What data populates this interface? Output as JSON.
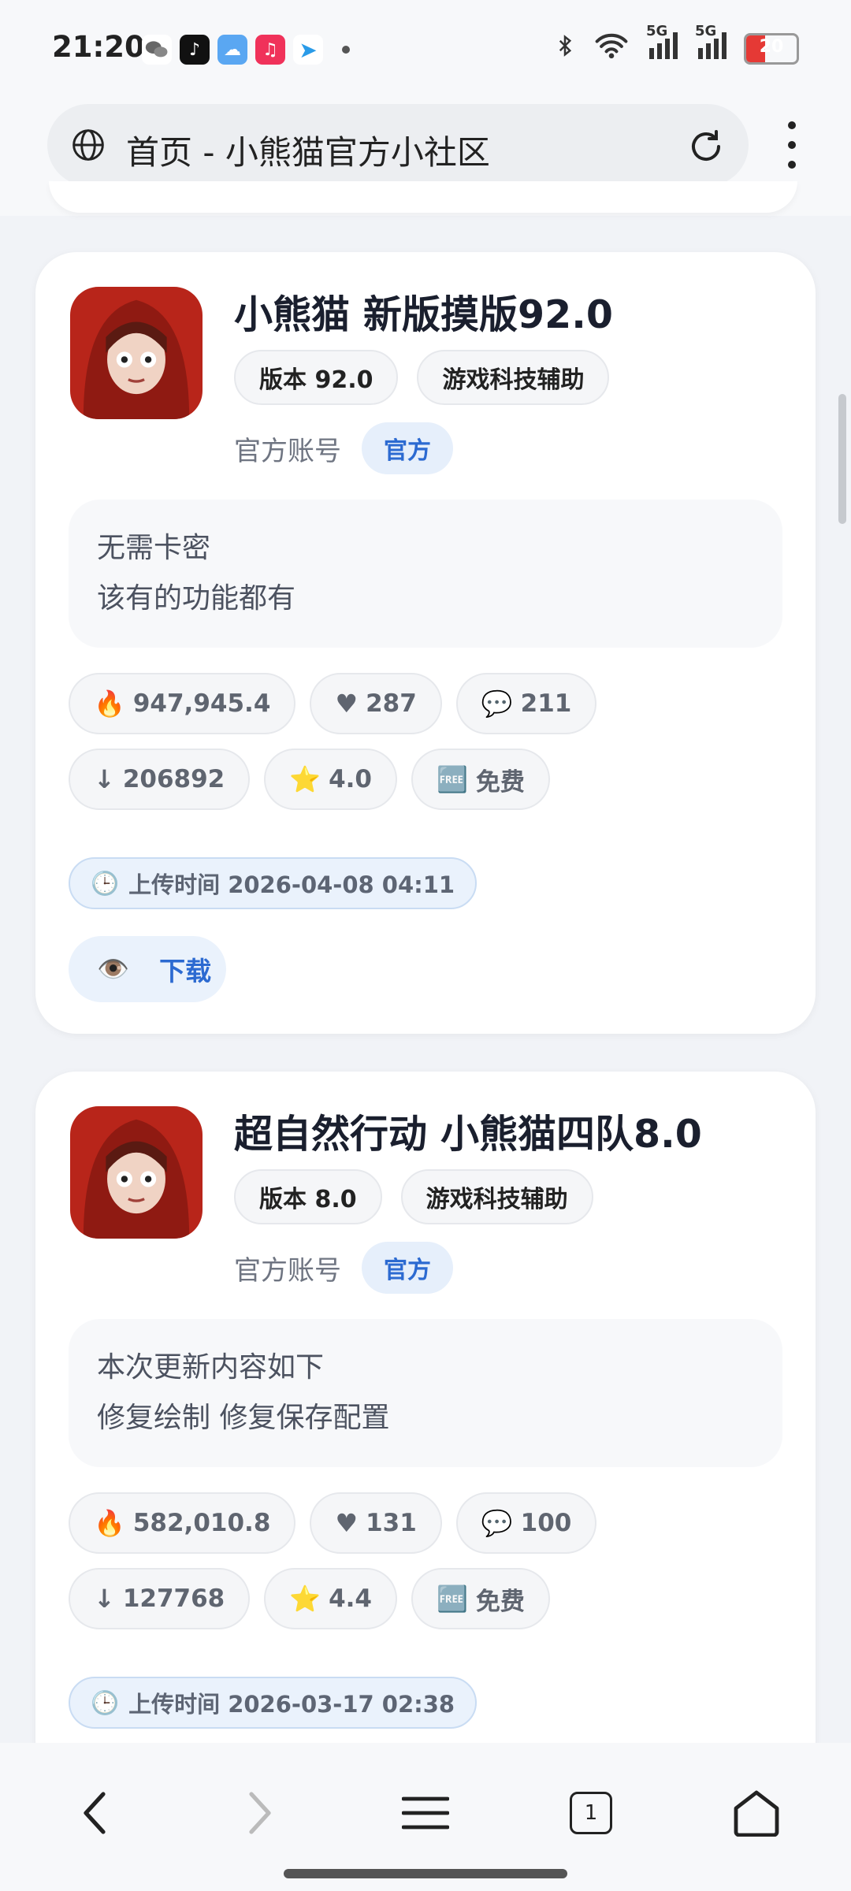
{
  "status_bar": {
    "time": "21:20",
    "battery": "20",
    "signal_labels": [
      "5G",
      "5G"
    ],
    "notification_icons": [
      "wechat-icon",
      "tiktok-icon",
      "weather-icon",
      "music-icon",
      "telegram-icon"
    ],
    "system_icons": [
      "bluetooth-icon",
      "wifi-icon",
      "signal-icon",
      "signal-icon",
      "battery-icon"
    ]
  },
  "browser": {
    "url_text": "首页 - 小熊猫官方小社区",
    "icons": [
      "globe-icon",
      "reload-icon",
      "more-menu-icon"
    ]
  },
  "cards": [
    {
      "title": "小熊猫 新版摸版92.0",
      "chips": [
        "版本 92.0",
        "游戏科技辅助"
      ],
      "account_label": "官方账号",
      "official_badge": "官方",
      "desc_lines": [
        "无需卡密",
        "该有的功能都有"
      ],
      "stats": [
        {
          "icon": "🔥",
          "value": "947,945.4",
          "name": "heat"
        },
        {
          "icon": "♥",
          "value": "287",
          "name": "likes"
        },
        {
          "icon": "💬",
          "value": "211",
          "name": "comments"
        },
        {
          "icon": "↓",
          "value": "206892",
          "name": "downloads"
        },
        {
          "icon": "⭐",
          "value": "4.0",
          "name": "rating"
        },
        {
          "icon": "🆓",
          "value": "免费",
          "name": "price"
        }
      ],
      "upload_icon": "🕒",
      "upload_time": "上传时间 2026-04-08 04:11",
      "download_icon": "👁️",
      "download_label": "下载"
    },
    {
      "title": "超自然行动 小熊猫四队8.0",
      "chips": [
        "版本 8.0",
        "游戏科技辅助"
      ],
      "account_label": "官方账号",
      "official_badge": "官方",
      "desc_lines": [
        "本次更新内容如下",
        "修复绘制 修复保存配置"
      ],
      "stats": [
        {
          "icon": "🔥",
          "value": "582,010.8",
          "name": "heat"
        },
        {
          "icon": "♥",
          "value": "131",
          "name": "likes"
        },
        {
          "icon": "💬",
          "value": "100",
          "name": "comments"
        },
        {
          "icon": "↓",
          "value": "127768",
          "name": "downloads"
        },
        {
          "icon": "⭐",
          "value": "4.4",
          "name": "rating"
        },
        {
          "icon": "🆓",
          "value": "免费",
          "name": "price"
        }
      ],
      "upload_icon": "🕒",
      "upload_time": "上传时间 2026-03-17 02:38"
    }
  ],
  "bottom_nav": {
    "tab_count": "1",
    "icons": [
      "back-icon",
      "forward-icon",
      "menu-icon",
      "tabs-icon",
      "home-icon"
    ]
  }
}
